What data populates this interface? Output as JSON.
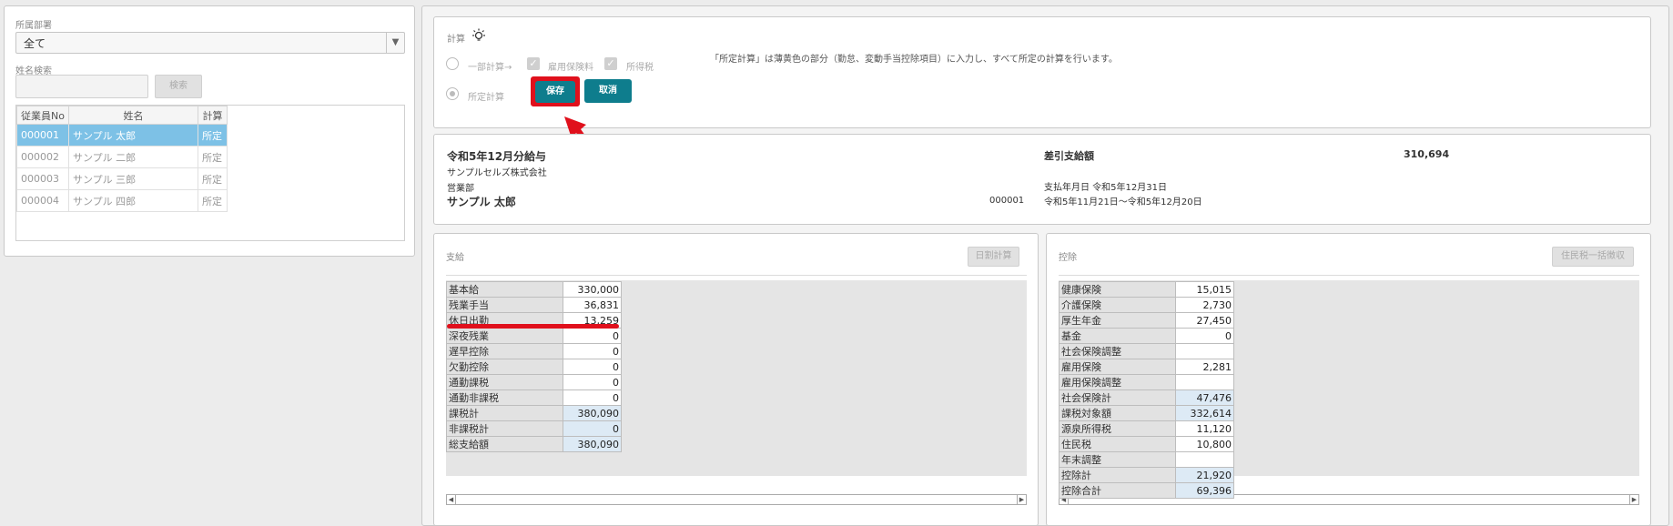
{
  "filters": {
    "dept_label": "所属部署",
    "dept_value": "全て",
    "name_search_label": "姓名検索",
    "name_search_value": "",
    "search_button": "検索"
  },
  "employee_table": {
    "headers": [
      "従業員No",
      "姓名",
      "計算"
    ],
    "rows": [
      {
        "no": "000001",
        "name": "サンプル 太郎",
        "calc": "所定"
      },
      {
        "no": "000002",
        "name": "サンプル 二郎",
        "calc": "所定"
      },
      {
        "no": "000003",
        "name": "サンプル 三郎",
        "calc": "所定"
      },
      {
        "no": "000004",
        "name": "サンプル 四郎",
        "calc": "所定"
      }
    ]
  },
  "calc": {
    "title": "計算",
    "icon": "lightbulb-icon",
    "partial_label": "一部計算→",
    "emp_insurance_label": "雇用保険料",
    "income_tax_label": "所得税",
    "standard_label": "所定計算",
    "save_button": "保存",
    "cancel_button": "取消",
    "note": "「所定計算」は薄黄色の部分（勤怠、変動手当控除項目）に入力し、すべて所定の計算を行います。"
  },
  "payslip": {
    "title": "令和5年12月分給与",
    "company": "サンプルセルズ株式会社",
    "department": "営業部",
    "employee_name": "サンプル 太郎",
    "employee_no": "000001",
    "net_pay_label": "差引支給額",
    "net_pay_value": "310,694",
    "pay_date": "支払年月日 令和5年12月31日",
    "period": "令和5年11月21日～令和5年12月20日"
  },
  "payments": {
    "title": "支給",
    "daily_calc_button": "日割計算",
    "rows": [
      {
        "label": "基本給",
        "value": "330,000"
      },
      {
        "label": "残業手当",
        "value": "36,831"
      },
      {
        "label": "休日出勤",
        "value": "13,259"
      },
      {
        "label": "深夜残業",
        "value": "0"
      },
      {
        "label": "遅早控除",
        "value": "0"
      },
      {
        "label": "欠勤控除",
        "value": "0"
      },
      {
        "label": "通勤課税",
        "value": "0"
      },
      {
        "label": "通勤非課税",
        "value": "0"
      },
      {
        "label": "課税計",
        "value": "380,090",
        "total": true
      },
      {
        "label": "非課税計",
        "value": "0",
        "total": true
      },
      {
        "label": "総支給額",
        "value": "380,090",
        "total": true
      }
    ]
  },
  "deductions": {
    "title": "控除",
    "resident_tax_button": "住民税一括徴収",
    "rows": [
      {
        "label": "健康保険",
        "value": "15,015"
      },
      {
        "label": "介護保険",
        "value": "2,730"
      },
      {
        "label": "厚生年金",
        "value": "27,450"
      },
      {
        "label": "基金",
        "value": "0"
      },
      {
        "label": "社会保険調整",
        "value": ""
      },
      {
        "label": "雇用保険",
        "value": "2,281"
      },
      {
        "label": "雇用保険調整",
        "value": ""
      },
      {
        "label": "社会保険計",
        "value": "47,476",
        "total": true
      },
      {
        "label": "課税対象額",
        "value": "332,614",
        "total": true
      },
      {
        "label": "源泉所得税",
        "value": "11,120"
      },
      {
        "label": "住民税",
        "value": "10,800"
      },
      {
        "label": "年末調整",
        "value": ""
      },
      {
        "label": "控除計",
        "value": "21,920",
        "total": true
      },
      {
        "label": "控除合計",
        "value": "69,396",
        "total": true
      }
    ]
  },
  "colors": {
    "accent": "#0e7d8d",
    "selected_row": "#7dc1e6",
    "highlight_red": "#e0101c"
  }
}
